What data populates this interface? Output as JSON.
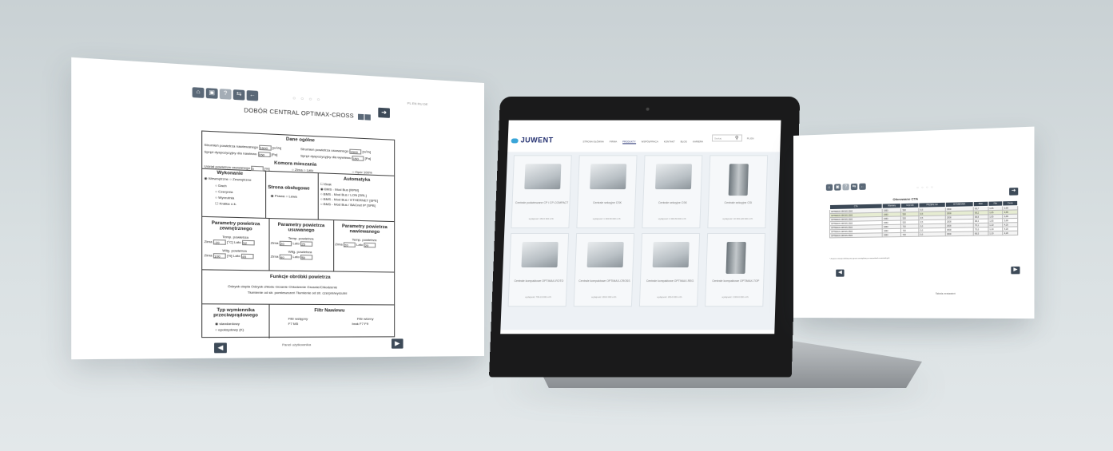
{
  "left_panel": {
    "title": "DOBÓR CENTRAL OPTIMAX-CROSS",
    "dots": "○ ○ ○ ○",
    "lang": "PL EN RU DE",
    "footer": "Panel użytkownika",
    "icons": [
      "home-icon",
      "save-icon",
      "help-icon",
      "switch-icon",
      "back-icon"
    ],
    "sections": {
      "dane_ogolne": "Dane ogólne",
      "supply_flow_label": "Strumień powietrza nawiewanego",
      "supply_flow_value": "1500",
      "supply_flow_unit": "[m³/h]",
      "exhaust_flow_label": "Strumień powietrza usuwanego",
      "exhaust_flow_value": "1500",
      "exhaust_flow_unit": "[m³/h]",
      "supply_pressure_label": "Spręż dyspozycyjny dla nawiewu",
      "supply_pressure_value": "150",
      "supply_pressure_unit": "[Pa]",
      "exhaust_pressure_label": "Spręż dyspozycyjny dla wywiewu",
      "exhaust_pressure_value": "150",
      "exhaust_pressure_unit": "[Pa]",
      "komora": "Komora mieszania",
      "udzial_label": "Udział powietrza usuwanego",
      "udzial_value": "0",
      "udzial_unit": "[%]",
      "komora_opts": [
        "Zima",
        "Lato",
        "Opór 100%"
      ],
      "wykonanie": "Wykonanie",
      "wykonanie_opts": [
        "Wewnętrzne",
        "Zewnętrzne"
      ],
      "wykonanie_extra": [
        "Dach",
        "Czerpnia",
        "Wyrzutnia",
        "Kratka o.k."
      ],
      "strona": "Strona obsługowe",
      "strona_opts": [
        "Prawa",
        "Lewa"
      ],
      "automatyka": "Automatyka",
      "automatyka_opts": [
        "Brak",
        "BMS - Mod Bus [RPM]",
        "BMS - Mod Bus / LON [SRL]",
        "BMS - Mod Bus / ETHERNET [SPE]",
        "BMS - Mod Bus / BACnet IP [SPB]"
      ],
      "param_zew": "Parametry powietrza zewnętrznego",
      "param_usu": "Parametry powietrza usuwanego",
      "param_naw": "Parametry powietrza nawiewanego",
      "temp": "Temp. powietrza",
      "wilg": "Wilg. powietrza",
      "zima": "Zima",
      "lato": "Lato",
      "zew_temp_zima": "-20",
      "zew_temp_lato": "32",
      "zew_wilg_zima": "100",
      "zew_wilg_lato": "45",
      "usu_temp_zima": "20",
      "usu_temp_lato": "25",
      "usu_wilg_zima": "40",
      "usu_wilg_lato": "50",
      "naw_temp_zima": "20",
      "naw_temp_lato": "20",
      "unit_c": "[°C]",
      "unit_pct": "[%]",
      "funkcje": "Funkcje obróbki powietrza",
      "funkcje_opts": "Odzysk ciepła  Odzysk chłodu  Grzanie  Chłodzenie  Grzanie/Chłodzenie",
      "funkcje_opts2": "Tłumienie od str. pomieszczeń  Tłumienie od str. czerpni/wyrzutni",
      "wymiennik": "Typ wymiennika przeciwprądowego",
      "wymiennik_opts": [
        "standardowy",
        "epoksydowy (K)"
      ],
      "filtr": "Filtr Nawiewu",
      "filtr_wstepny": "Filtr wstępny",
      "filtr_wstepny_opts": "F7  M5",
      "filtr_wtorny": "Filtr wtórny",
      "filtr_wtorny_opts": "brak  F7  F9"
    }
  },
  "laptop": {
    "brand": "JUWENT",
    "nav": [
      "STRONA GŁÓWNA",
      "FIRMA",
      "PRODUKTY",
      "WSPÓŁPRACA",
      "KONTAKT",
      "BLOG",
      "KARIERA"
    ],
    "active_nav": "PRODUKTY",
    "search_placeholder": "Szukaj",
    "lang": "PL EN",
    "products": [
      {
        "name": "Centrale podwieszane CP i CP-COMPACT",
        "sub": "wydajność: 150-6 300 m³/h"
      },
      {
        "name": "Centrale sekcyjne CSK",
        "sub": "wydajność: 1 000-50 000 m³/h"
      },
      {
        "name": "Centrale sekcyjne CSK",
        "sub": "wydajność: 2 000-50 000 m³/h"
      },
      {
        "name": "Centrale sekcyjne CSI",
        "sub": "wydajność: 10 000-120 000 m³/h"
      },
      {
        "name": "Centrale kompaktowe OPTIMAX-ROTO",
        "sub": "wydajność: 700-13 000 m³/h"
      },
      {
        "name": "Centrale kompaktowe OPTIMAX-CROSS",
        "sub": "wydajność: 200-6 000 m³/h"
      },
      {
        "name": "Centrale kompaktowe OPTIMAX-REG",
        "sub": "wydajność: 200-9 000 m³/h"
      },
      {
        "name": "Centrale kompaktowe OPTIMAX-TOP",
        "sub": "wydajność: 2 000-6 000 m³/h"
      }
    ]
  },
  "right_panel": {
    "title": "Oferowane CTA",
    "dots": "○ ○ ○ ○",
    "headers": [
      "CTA",
      "Wymiary",
      "Czynnik",
      "PRZEPŁYW",
      "WYMIENNIK",
      "Moc",
      "Filtr",
      "Cena"
    ],
    "rows": [
      [
        "OPTIMAX-CROSS 1500",
        "1950",
        "520",
        "0,5",
        "1500",
        "69,7",
        "1,05",
        "3,89"
      ],
      [
        "OPTIMAX-CROSS 1500",
        "1950",
        "520",
        "0,5",
        "1500",
        "69,2",
        "1,05",
        "3,89"
      ],
      [
        "OPTIMAX-CROSS 1500",
        "1950",
        "520",
        "0,5",
        "1500",
        "68,8",
        "1,05",
        "3,89"
      ],
      [
        "OPTIMAX-CROSS 1500",
        "1950",
        "520",
        "0,5",
        "1500",
        "68,4",
        "1,05",
        "3,89"
      ],
      [
        "OPTIMAX-CROSS 2500",
        "1950",
        "720",
        "0,6",
        "1500",
        "70,1",
        "1,10",
        "4,20"
      ],
      [
        "OPTIMAX-CROSS 2500",
        "1950",
        "720",
        "0,6",
        "1500",
        "70,0",
        "1,10",
        "4,20"
      ],
      [
        "OPTIMAX-CROSS 2500",
        "1950",
        "720",
        "0,6",
        "1500",
        "69,5",
        "1,10",
        "4,20"
      ]
    ],
    "highlight_row": 1,
    "note": "* Zużycie energii elektrycznej przez wentylatory w warunkach nominalnych",
    "link": "Tabela zestawień"
  }
}
